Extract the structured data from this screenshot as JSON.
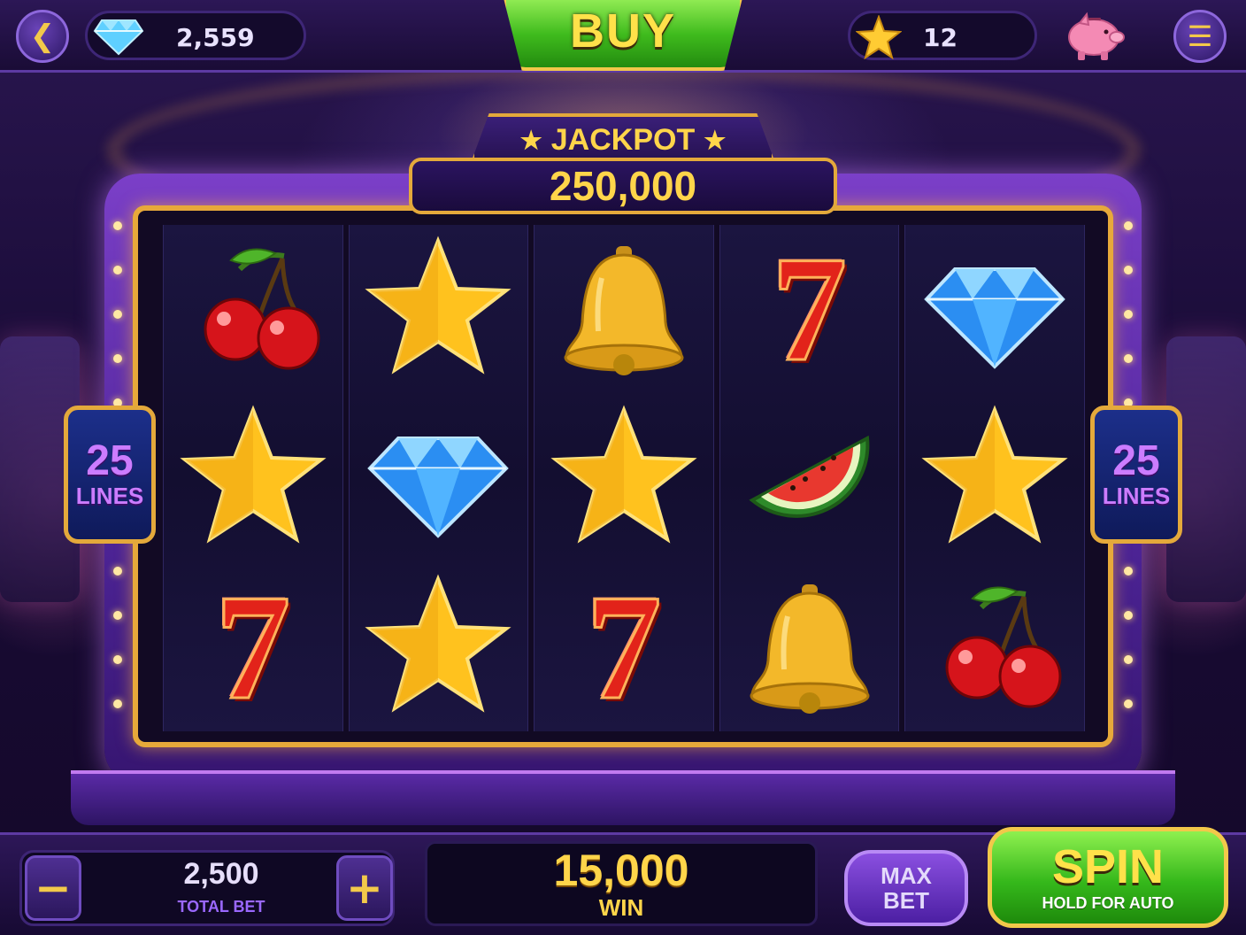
{
  "top_bar": {
    "gems": "2,559",
    "stars": "12",
    "buy_label": "BUY"
  },
  "jackpot": {
    "label": "JACKPOT",
    "value": "250,000"
  },
  "lines": {
    "count": "25",
    "label": "LINES"
  },
  "reels": [
    [
      "cherry",
      "star",
      "seven"
    ],
    [
      "star",
      "diamond",
      "star"
    ],
    [
      "bell",
      "star",
      "seven"
    ],
    [
      "seven",
      "watermelon",
      "bell"
    ],
    [
      "diamond",
      "star",
      "cherry"
    ]
  ],
  "bottom_bar": {
    "minus_label": "−",
    "plus_label": "+",
    "total_bet_value": "2,500",
    "total_bet_label": "TOTAL BET",
    "win_value": "15,000",
    "win_label": "WIN",
    "max_bet_line1": "MAX",
    "max_bet_line2": "BET",
    "spin_label": "SPIN",
    "spin_sub": "HOLD FOR AUTO"
  },
  "colors": {
    "gold": "#e4a93b",
    "purple": "#5d3aa3",
    "green": "#3fbb1d",
    "seven_red": "#e2231a"
  }
}
